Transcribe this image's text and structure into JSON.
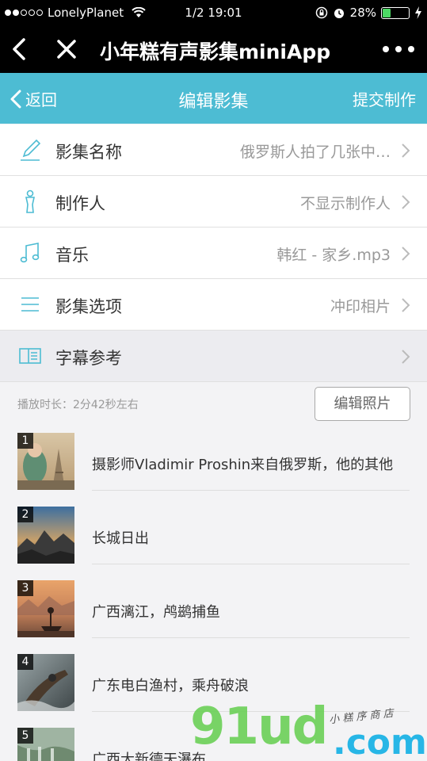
{
  "status": {
    "carrier": "LonelyPlanet",
    "time": "1/2 19:01",
    "battery": "28%",
    "battery_level": 0.28,
    "signal_bars": 2
  },
  "app_bar": {
    "title": "小年糕有声影集miniApp"
  },
  "nav": {
    "back": "返回",
    "title": "编辑影集",
    "submit": "提交制作"
  },
  "settings": [
    {
      "icon": "pencil-icon",
      "label": "影集名称",
      "value": "俄罗斯人拍了几张中…"
    },
    {
      "icon": "person-icon",
      "label": "制作人",
      "value": "不显示制作人"
    },
    {
      "icon": "music-note-icon",
      "label": "音乐",
      "value": "韩红 - 家乡.mp3"
    },
    {
      "icon": "list-icon",
      "label": "影集选项",
      "value": "冲印相片"
    },
    {
      "icon": "book-icon",
      "label": "字幕参考",
      "value": ""
    }
  ],
  "info": {
    "duration": "播放时长：2分42秒左右",
    "edit_photos": "编辑照片"
  },
  "photos": [
    {
      "index": "1",
      "caption": "摄影师Vladimir Proshin来自俄罗斯，他的其他"
    },
    {
      "index": "2",
      "caption": "长城日出"
    },
    {
      "index": "3",
      "caption": "广西漓江，鸬鹚捕鱼"
    },
    {
      "index": "4",
      "caption": "广东电白渔村，乘舟破浪"
    },
    {
      "index": "5",
      "caption": "广西大新德天瀑布"
    }
  ],
  "watermark": {
    "brand": "91ud",
    "domain": ".com",
    "slogan": "小 糕 序 商 店"
  }
}
